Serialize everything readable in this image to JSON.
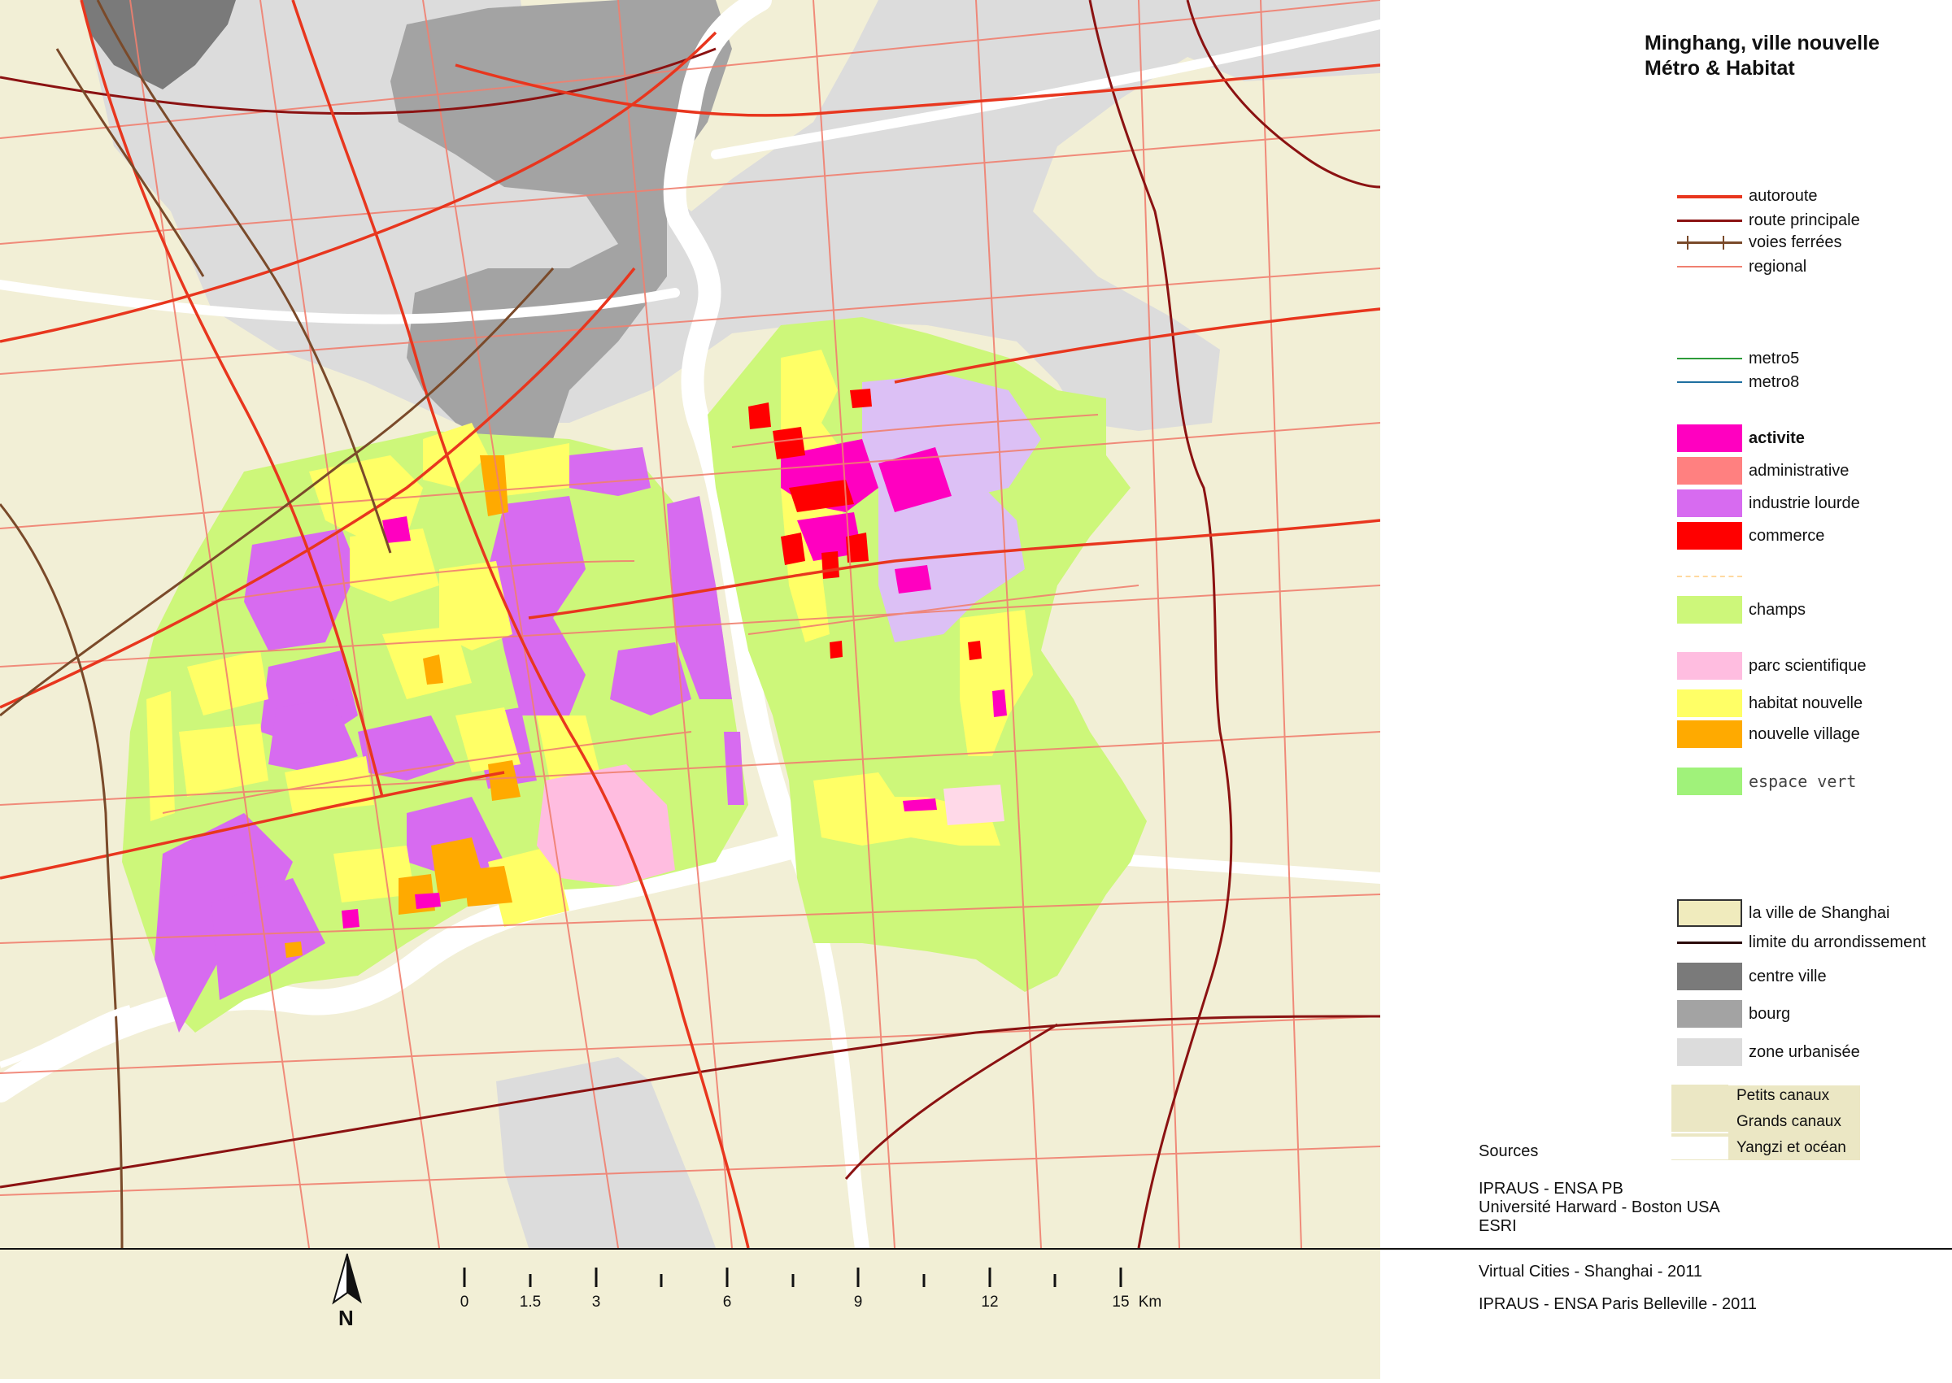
{
  "title": {
    "line1": "Minghang, ville nouvelle",
    "line2": "Métro & Habitat"
  },
  "legend": {
    "lines": [
      {
        "label": "autoroute",
        "color": "#e8361e",
        "style": "solid"
      },
      {
        "label": "route principale",
        "color": "#8b1212",
        "style": "solid"
      },
      {
        "label": "voies ferrées",
        "color": "#7a4a2a",
        "style": "rail"
      },
      {
        "label": "regional",
        "color": "#f08070",
        "style": "solid"
      }
    ],
    "metro": [
      {
        "label": "metro5",
        "color": "#2e9b3a"
      },
      {
        "label": "metro8",
        "color": "#1e6fa0"
      }
    ],
    "landuse": [
      {
        "label": "activite",
        "color": "#ff00c0",
        "bold": true
      },
      {
        "label": "administrative",
        "color": "#ff8080"
      },
      {
        "label": "industrie lourde",
        "color": "#d76bf0"
      },
      {
        "label": "commerce",
        "color": "#ff0000"
      },
      {
        "label": "",
        "color": "#ffd9a0",
        "dashed": true
      },
      {
        "label": "champs",
        "color": "#cdf77a"
      },
      {
        "label": "parc scientifique",
        "color": "#ffbde0"
      },
      {
        "label": "habitat nouvelle",
        "color": "#ffff66"
      },
      {
        "label": "nouvelle village",
        "color": "#ffaa00"
      },
      {
        "label": "espace vert",
        "color": "#a0f27a",
        "mono": true
      }
    ],
    "context": [
      {
        "label": "la ville de Shanghai",
        "color": "#f0ebbd",
        "outline": true
      },
      {
        "label": "limite du arrondissement",
        "color": "#5a1010",
        "isLine": true
      },
      {
        "label": "centre ville",
        "color": "#7a7a7a"
      },
      {
        "label": "bourg",
        "color": "#a3a3a3"
      },
      {
        "label": "zone urbanisée",
        "color": "#dcdcdc"
      }
    ],
    "canals": [
      {
        "label": "Petits canaux",
        "color": "#ebe7c4"
      },
      {
        "label": "Grands canaux",
        "color": "#ebe7c4"
      },
      {
        "label": "Yangzi et océan",
        "color": "#ffffff"
      }
    ]
  },
  "sources": {
    "heading": "Sources",
    "items": [
      "IPRAUS - ENSA PB",
      "Université Harward - Boston USA",
      "ESRI"
    ]
  },
  "credits": {
    "line1": "Virtual Cities - Shanghai - 2011",
    "line2": "IPRAUS - ENSA Paris Belleville - 2011"
  },
  "scalebar": {
    "ticks": [
      "0",
      "1.5",
      "3",
      "6",
      "9",
      "12",
      "15"
    ],
    "unit": "Km"
  },
  "north_label": "N"
}
